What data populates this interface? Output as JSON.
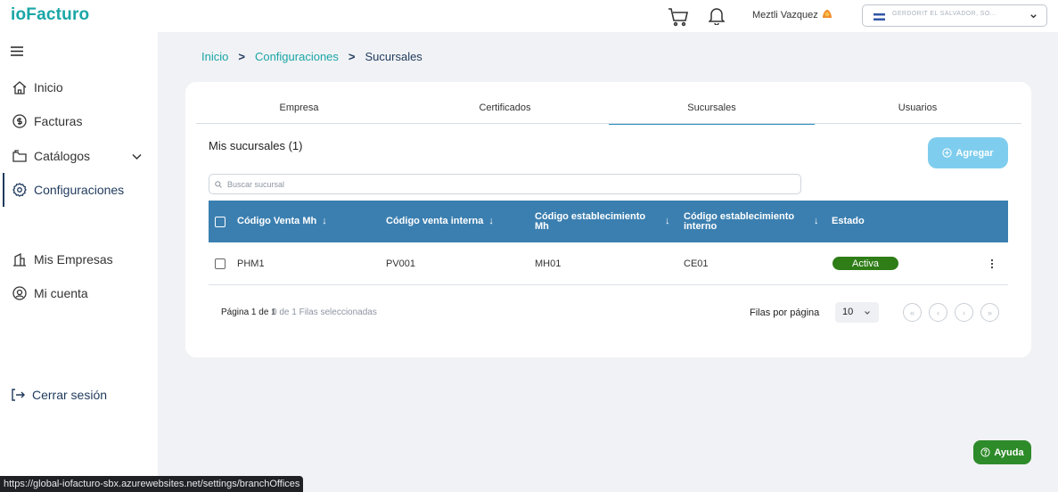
{
  "app": {
    "logo": "ioFacturo"
  },
  "header": {
    "user_name": "Meztli Vazquez",
    "company_name": "GERDORIT EL SALVADOR, SO..."
  },
  "sidebar": {
    "items": [
      {
        "label": "Inicio",
        "icon": "home-icon"
      },
      {
        "label": "Facturas",
        "icon": "dollar-circle-icon"
      },
      {
        "label": "Catálogos",
        "icon": "folder-icon"
      },
      {
        "label": "Configuraciones",
        "icon": "settings-icon"
      },
      {
        "label": "Mis Empresas",
        "icon": "building-icon"
      },
      {
        "label": "Mi cuenta",
        "icon": "user-circle-icon"
      }
    ],
    "logout_label": "Cerrar sesión"
  },
  "breadcrumb": {
    "home": "Inicio",
    "section": "Configuraciones",
    "current": "Sucursales"
  },
  "tabs": [
    "Empresa",
    "Certificados",
    "Sucursales",
    "Usuarios"
  ],
  "main": {
    "list_title": "Mis sucursales (1)",
    "add_label": "Agregar",
    "search_placeholder": "Buscar sucursal"
  },
  "table": {
    "headers": {
      "col1": "Código Venta Mh",
      "col2": "Código venta interna",
      "col3_line1": "Código establecimiento",
      "col3_line2": "Mh",
      "col4_line1": "Código establecimiento",
      "col4_line2": "interno",
      "col5": "Estado",
      "sort_arrow": "↓"
    },
    "rows": [
      {
        "codigo_venta_mh": "PHM1",
        "codigo_venta_interna": "PV001",
        "codigo_establecimiento_mh": "MH01",
        "codigo_establecimiento_interno": "CE01",
        "estado": "Activa"
      }
    ]
  },
  "pagination": {
    "page_info": "Página 1 de 1",
    "selected_info": "0 de 1 Filas seleccionadas",
    "rows_label": "Filas por página",
    "rows_value": "10",
    "buttons": [
      "«",
      "‹",
      "›",
      "»"
    ]
  },
  "help_label": "Ayuda",
  "status_url": "https://global-iofacturo-sbx.azurewebsites.net/settings/branchOffices",
  "colors": {
    "accent": "#1aa6a6",
    "table_header": "#3b7fb0",
    "status_active": "#2e7d17",
    "add_button": "#7fcdee",
    "help_button": "#2e8b2a"
  }
}
